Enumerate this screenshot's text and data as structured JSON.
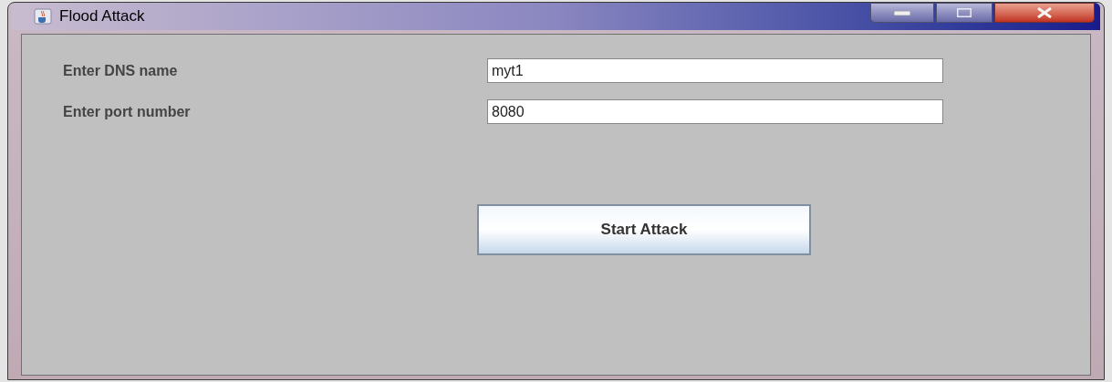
{
  "window": {
    "title": "Flood Attack"
  },
  "fields": [
    {
      "label": "Enter DNS name",
      "value": "myt1"
    },
    {
      "label": "Enter port number",
      "value": "8080"
    }
  ],
  "buttons": [
    "Start Attack"
  ]
}
